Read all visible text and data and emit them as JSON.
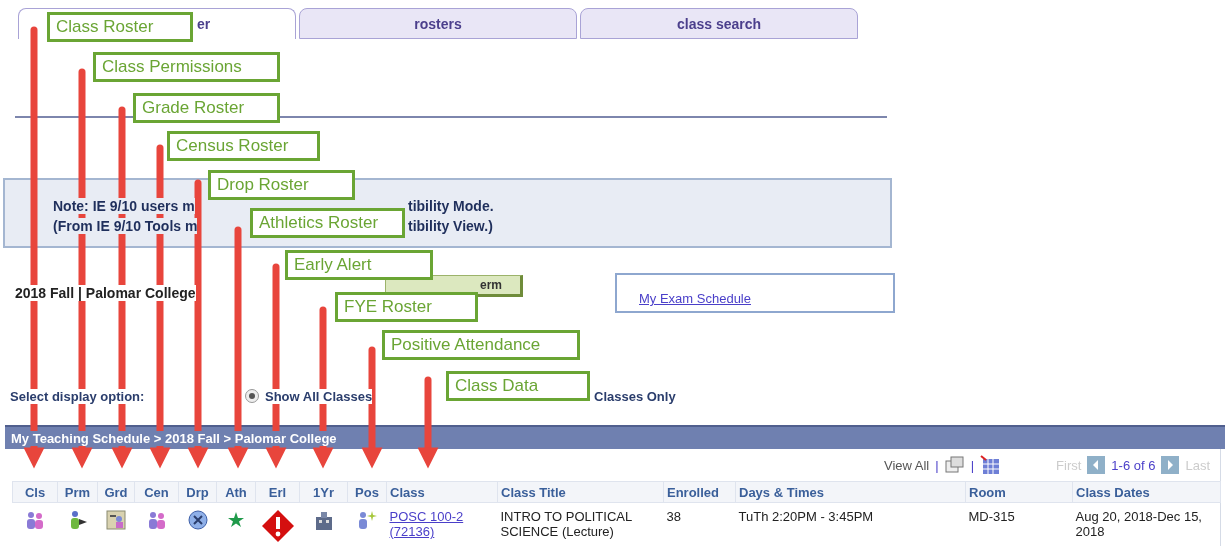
{
  "tabs": [
    {
      "label": "er",
      "selected": true
    },
    {
      "label": "rosters",
      "selected": false
    },
    {
      "label": "class search",
      "selected": false
    }
  ],
  "notice": {
    "line_1_start": "Note: IE 9/10 users m",
    "line_1_end": "tibility Mode.",
    "line_2_start": "(From IE 9/10 Tools m",
    "line_2_end": "tibility View.)"
  },
  "term": {
    "label": "2018 Fall | Palomar College",
    "button": "erm"
  },
  "exam_link": "My Exam Schedule",
  "display_option": {
    "label": "Select display option:",
    "options": [
      {
        "label": "Show All Classes",
        "selected": true
      },
      {
        "label": "Classes Only",
        "selected": false
      }
    ]
  },
  "schedule_header": "My Teaching Schedule > 2018 Fall > Palomar College",
  "pager": {
    "view_all": "View All",
    "separator_1": "|",
    "separator_2": "|",
    "first": "First",
    "first_disabled": true,
    "range": "1-6 of 6",
    "last": "Last",
    "last_disabled": true
  },
  "table": {
    "columns": [
      {
        "label": "Cls",
        "kind": "icon"
      },
      {
        "label": "Prm",
        "kind": "icon"
      },
      {
        "label": "Grd",
        "kind": "icon"
      },
      {
        "label": "Cen",
        "kind": "icon"
      },
      {
        "label": "Drp",
        "kind": "icon"
      },
      {
        "label": "Ath",
        "kind": "icon"
      },
      {
        "label": "Erl",
        "kind": "icon"
      },
      {
        "label": "1Yr",
        "kind": "icon"
      },
      {
        "label": "Pos",
        "kind": "icon"
      },
      {
        "label": "Class",
        "kind": "link"
      },
      {
        "label": "Class Title",
        "kind": "text"
      },
      {
        "label": "Enrolled",
        "kind": "text"
      },
      {
        "label": "Days & Times",
        "kind": "text"
      },
      {
        "label": "Room",
        "kind": "text"
      },
      {
        "label": "Class Dates",
        "kind": "text"
      }
    ],
    "rows": [
      {
        "cells": [
          "",
          "",
          "",
          "",
          "",
          "",
          "",
          "",
          "",
          "POSC 100-2 (72136)",
          "INTRO TO POLITICAL SCIENCE (Lecture)",
          "38",
          "TuTh 2:20PM - 3:45PM",
          "MD-315",
          "Aug 20, 2018-Dec 15, 2018"
        ]
      }
    ]
  },
  "callouts": [
    {
      "label": "Class Roster"
    },
    {
      "label": "Class Permissions"
    },
    {
      "label": "Grade Roster"
    },
    {
      "label": "Census Roster"
    },
    {
      "label": "Drop Roster"
    },
    {
      "label": "Athletics Roster"
    },
    {
      "label": "Early Alert"
    },
    {
      "label": "FYE Roster"
    },
    {
      "label": "Positive Attendance"
    },
    {
      "label": "Class Data"
    }
  ]
}
